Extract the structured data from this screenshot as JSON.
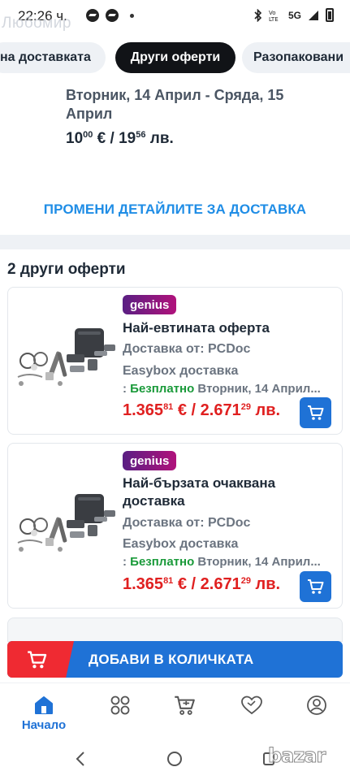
{
  "status_bar": {
    "time": "22:26 ч.",
    "network": "5G"
  },
  "ghost_brand": "Любомир",
  "tabs": [
    {
      "label": "на доставката"
    },
    {
      "label": "Други оферти"
    },
    {
      "label": "Разопаковани"
    }
  ],
  "delivery": {
    "dates": "Вторник, 14 Април - Сряда, 15 Април",
    "price_eur_int": "10",
    "price_eur_dec": "00",
    "price_sep": " € / ",
    "price_bgn_int": "19",
    "price_bgn_dec": "56",
    "price_bgn_unit": " лв.",
    "change_link": "ПРОМЕНИ ДЕТАЙЛИТЕ ЗА ДОСТАВКА"
  },
  "offers_title": "2 други оферти",
  "offers": [
    {
      "badge": "genius",
      "label": "Най-евтината оферта",
      "seller": "Доставка от: PCDoc",
      "shipping": "Easybox доставка",
      "ship_prefix": ": ",
      "free": "Безплатно",
      "ship_date": " Вторник, 14 Април...",
      "price_eur_int": "1.365",
      "price_eur_dec": "81",
      "price_sep": " € / ",
      "price_bgn_int": "2.671",
      "price_bgn_dec": "29",
      "price_bgn_unit": " лв."
    },
    {
      "badge": "genius",
      "label": "Най-бързата очаквана доставка",
      "seller": "Доставка от: PCDoc",
      "shipping": "Easybox доставка",
      "ship_prefix": ": ",
      "free": "Безплатно",
      "ship_date": " Вторник, 14 Април...",
      "price_eur_int": "1.365",
      "price_eur_dec": "81",
      "price_sep": " € / ",
      "price_bgn_int": "2.671",
      "price_bgn_dec": "29",
      "price_bgn_unit": " лв."
    }
  ],
  "add_to_cart": "ДОБАВИ В КОЛИЧКАТА",
  "bottom_nav": {
    "home": "Начало"
  },
  "watermark": "bazar",
  "colors": {
    "accent": "#1f72d6",
    "link": "#1f8de6",
    "price": "#e02020",
    "free": "#1a9a3a",
    "cart_red": "#ef2a32"
  }
}
